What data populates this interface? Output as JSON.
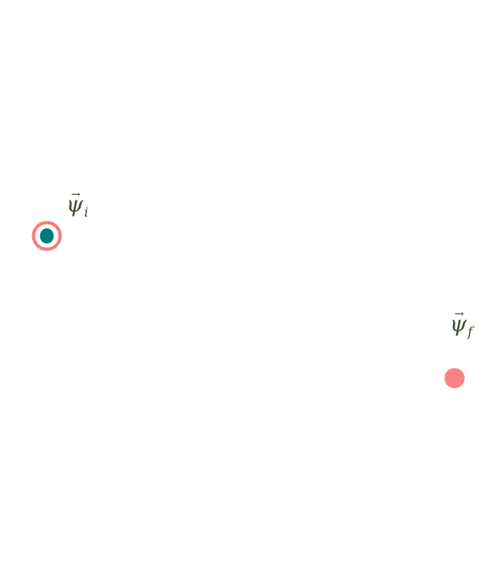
{
  "colors": {
    "background": "#ffffff",
    "ring": "#f97a7a",
    "inner": "#007a78",
    "target": "#f98282",
    "label_text": "#3b4a2e"
  },
  "labels": {
    "initial": {
      "symbol": "ψ",
      "arrow": "→",
      "subscript": "i"
    },
    "final": {
      "symbol": "ψ",
      "arrow": "→",
      "subscript": "f"
    }
  },
  "nodes": [
    {
      "id": "initial-state",
      "style": "ring-with-dot"
    },
    {
      "id": "final-state",
      "style": "filled-dot"
    }
  ]
}
